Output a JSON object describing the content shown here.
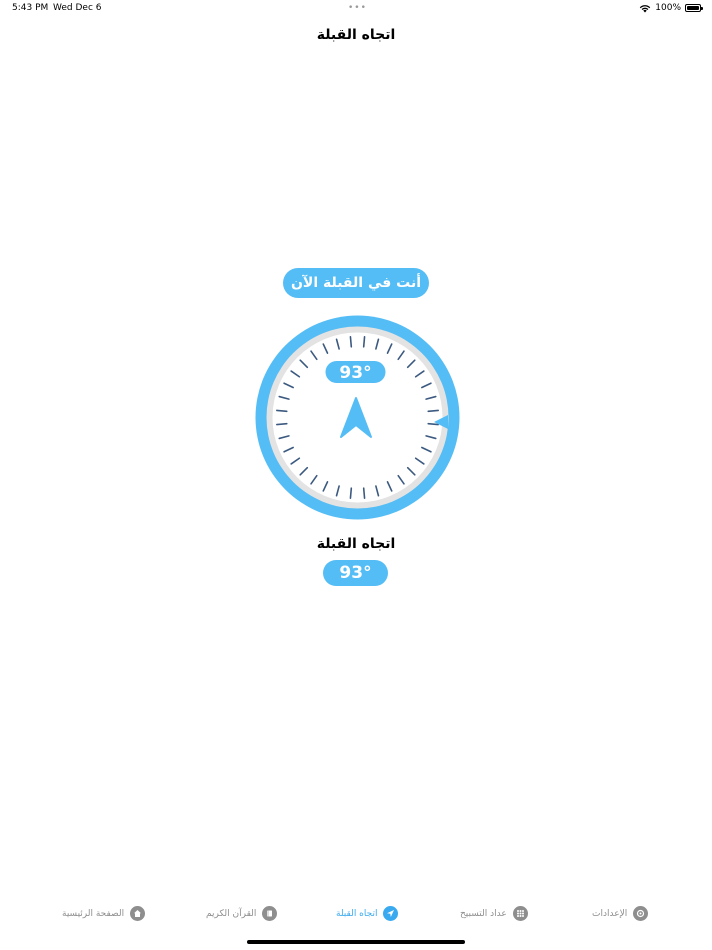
{
  "status_bar": {
    "time": "5:43 PM",
    "date": "Wed Dec 6",
    "battery": "100%",
    "battery_level": 1.0,
    "icons": [
      "wifi-icon",
      "battery-icon"
    ]
  },
  "header": {
    "title": "اتجاه القبلة"
  },
  "qibla": {
    "status_message": "أنت في القبلة الآن",
    "compass_degree": "93°",
    "label": "اتجاه القبلة",
    "degree": "93°",
    "heading": 93
  },
  "colors": {
    "accent": "#55bdf5",
    "accent_dark": "#3aaaf0",
    "ring_inner": "#e3e3e3",
    "tick": "#3c5a80",
    "inactive": "#8e8e8e"
  },
  "tab_bar": {
    "items": [
      {
        "label": "الإعدادات",
        "icon": "settings-icon",
        "active": false
      },
      {
        "label": "عداد التسبيح",
        "icon": "tasbih-counter-icon",
        "active": false
      },
      {
        "label": "اتجاه القبلة",
        "icon": "location-arrow-icon",
        "active": true
      },
      {
        "label": "القرآن الكريم",
        "icon": "book-icon",
        "active": false
      },
      {
        "label": "الصفحة الرئيسية",
        "icon": "home-icon",
        "active": false
      }
    ]
  }
}
